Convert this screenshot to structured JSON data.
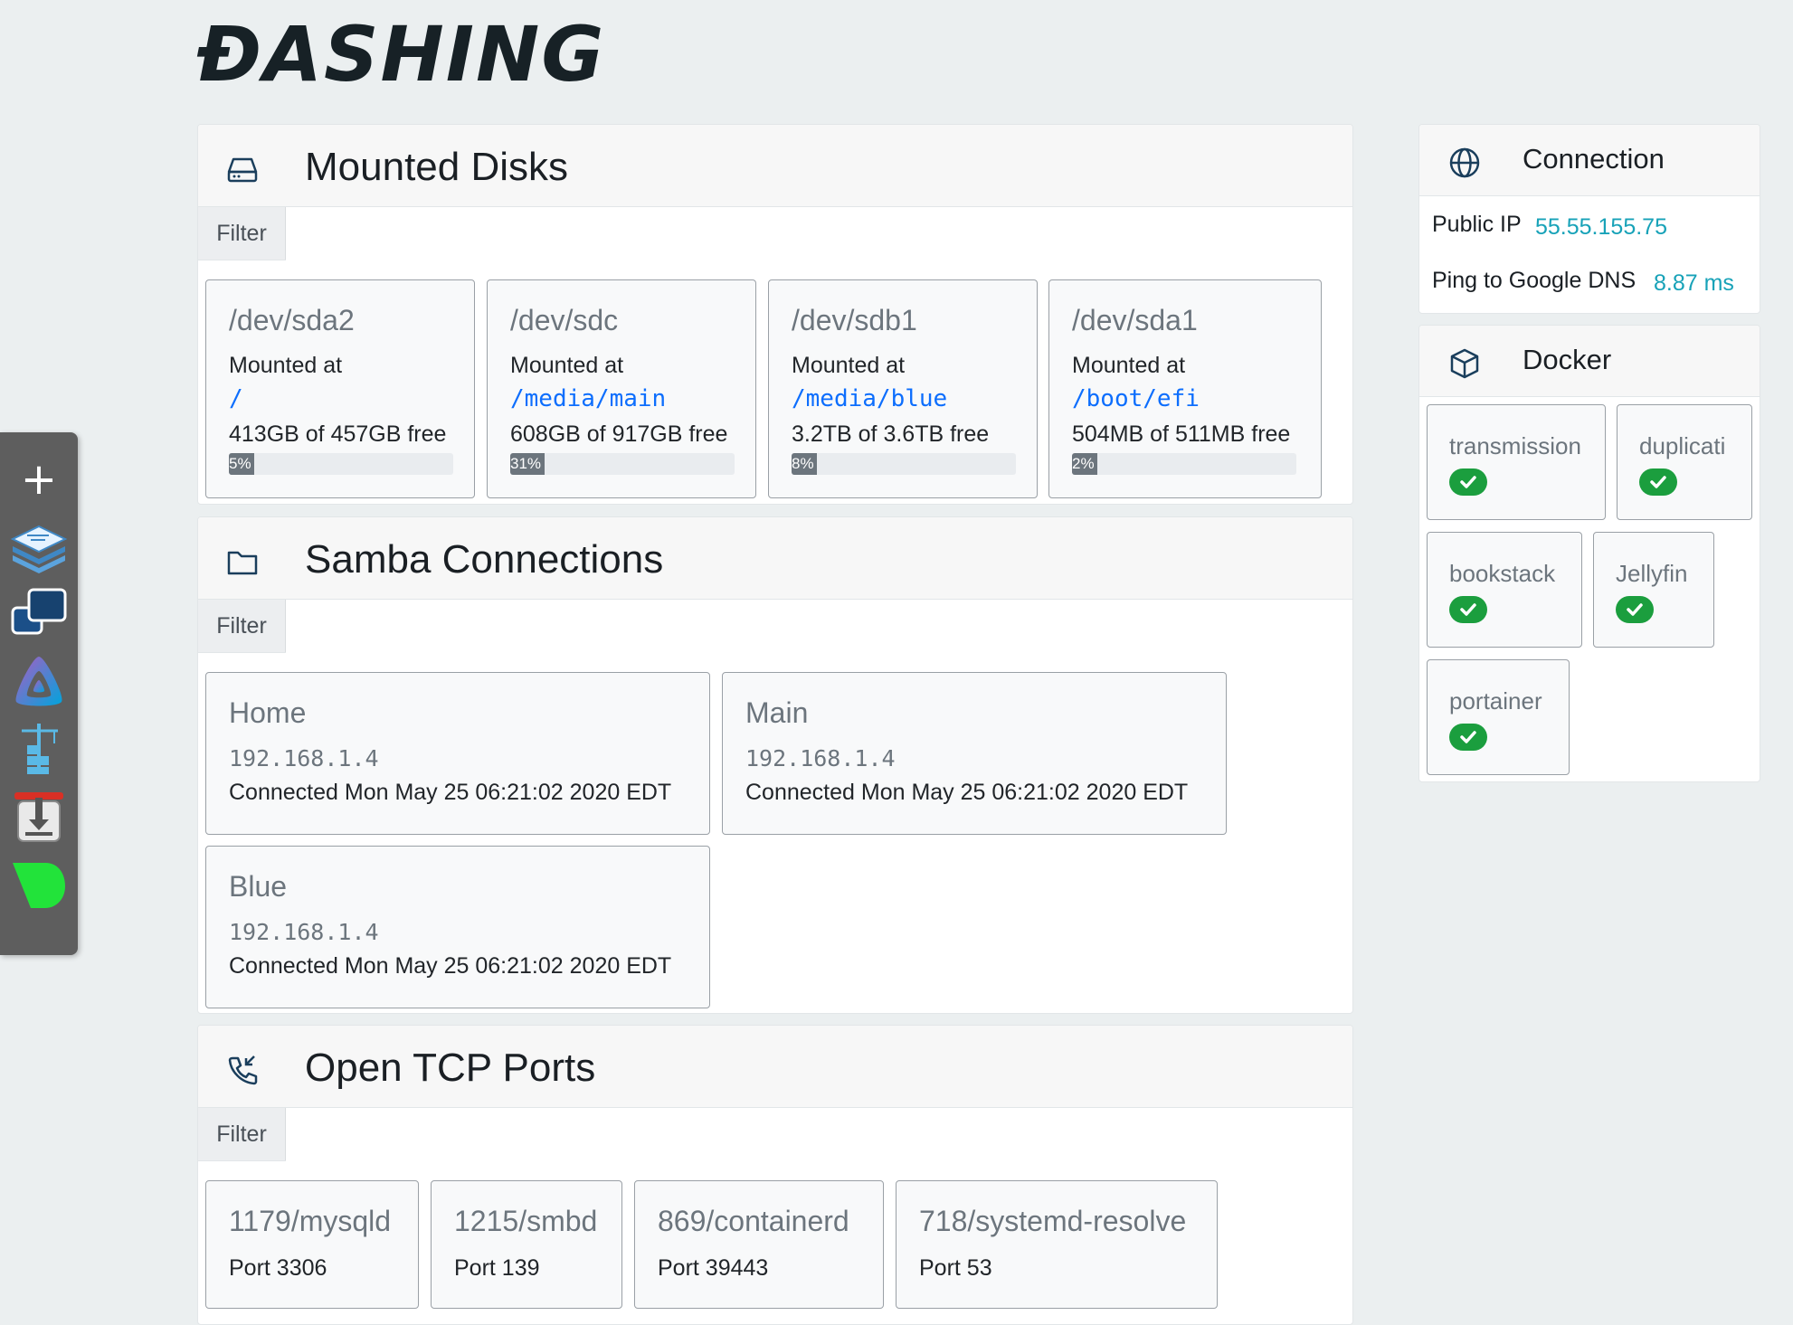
{
  "app": {
    "logo": "ĐASHING"
  },
  "dock": {
    "items": [
      {
        "name": "add-app",
        "icon": "plus-icon",
        "label": "+"
      },
      {
        "name": "stacked-layers-app",
        "icon": "stacked-layers-icon"
      },
      {
        "name": "remote-desktop-app",
        "icon": "remote-desktop-icon"
      },
      {
        "name": "jellyfin-app",
        "icon": "jellyfin-icon"
      },
      {
        "name": "docker-app",
        "icon": "docker-crane-icon"
      },
      {
        "name": "transmission-app",
        "icon": "transmission-icon"
      },
      {
        "name": "green-app",
        "icon": "green-leaf-icon"
      }
    ]
  },
  "mounted_disks": {
    "title": "Mounted Disks",
    "filter_label": "Filter",
    "filter_value": "",
    "mounted_at_label": "Mounted at",
    "disks": [
      {
        "device": "/dev/sda2",
        "mount": "/",
        "usage": "413GB of 457GB free",
        "percent": 5,
        "percent_label": "5%"
      },
      {
        "device": "/dev/sdc",
        "mount": "/media/main",
        "usage": "608GB of 917GB free",
        "percent": 31,
        "percent_label": "31%"
      },
      {
        "device": "/dev/sdb1",
        "mount": "/media/blue",
        "usage": "3.2TB of 3.6TB free",
        "percent": 8,
        "percent_label": "8%"
      },
      {
        "device": "/dev/sda1",
        "mount": "/boot/efi",
        "usage": "504MB of 511MB free",
        "percent": 2,
        "percent_label": "2%"
      }
    ]
  },
  "samba": {
    "title": "Samba Connections",
    "filter_label": "Filter",
    "filter_value": "",
    "connections": [
      {
        "share": "Home",
        "ip": "192.168.1.4",
        "connected": "Connected Mon May 25 06:21:02 2020 EDT"
      },
      {
        "share": "Main",
        "ip": "192.168.1.4",
        "connected": "Connected Mon May 25 06:21:02 2020 EDT"
      },
      {
        "share": "Blue",
        "ip": "192.168.1.4",
        "connected": "Connected Mon May 25 06:21:02 2020 EDT"
      }
    ]
  },
  "tcp_ports": {
    "title": "Open TCP Ports",
    "filter_label": "Filter",
    "filter_value": "",
    "ports": [
      {
        "process": "1179/mysqld",
        "port": "Port 3306"
      },
      {
        "process": "1215/smbd",
        "port": "Port 139"
      },
      {
        "process": "869/containerd",
        "port": "Port 39443"
      },
      {
        "process": "718/systemd-resolve",
        "port": "Port 53"
      }
    ]
  },
  "connection": {
    "title": "Connection",
    "public_ip_label": "Public IP",
    "public_ip": "55.55.155.75",
    "ping_label": "Ping to Google DNS",
    "ping": "8.87 ms"
  },
  "docker": {
    "title": "Docker",
    "containers": [
      {
        "name": "transmission",
        "status": "running"
      },
      {
        "name": "duplicati",
        "status": "running"
      },
      {
        "name": "bookstack",
        "status": "running"
      },
      {
        "name": "Jellyfin",
        "status": "running"
      },
      {
        "name": "portainer",
        "status": "running"
      }
    ]
  },
  "colors": {
    "background": "#ebeff0",
    "link": "#0d6efd",
    "accent": "#17a2b8",
    "status_ok": "#1b9e3e",
    "progress": "#6c757d"
  }
}
